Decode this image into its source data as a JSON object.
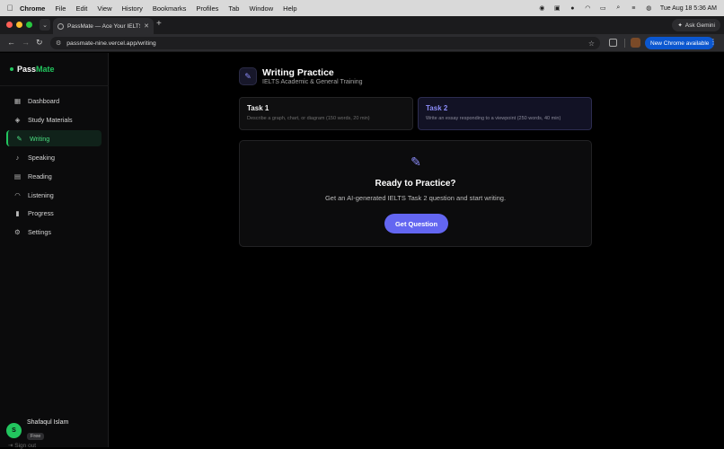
{
  "menubar": {
    "apple": "",
    "items": [
      "Chrome",
      "File",
      "Edit",
      "View",
      "History",
      "Bookmarks",
      "Profiles",
      "Tab",
      "Window",
      "Help"
    ],
    "datetime": "Tue Aug 18  5:36 AM"
  },
  "browser": {
    "tab_title": "PassMate — Ace Your IELTS",
    "tab_close": "✕",
    "new_tab": "+",
    "ask_gemini": "Ask Gemini",
    "url": "passmate-nine.vercel.app/writing",
    "update_label": "New Chrome available",
    "traffic_lights": {
      "close": "#ff5f57",
      "minimize": "#febc2e",
      "zoom": "#28c840"
    }
  },
  "sidebar": {
    "brand_part1": "Pass",
    "brand_part2": "Mate",
    "brand_color": "#22c55e",
    "items": [
      {
        "label": "Dashboard",
        "icon": "grid-icon"
      },
      {
        "label": "Study Materials",
        "icon": "graduation-cap-icon"
      },
      {
        "label": "Writing",
        "icon": "pen-nib-icon",
        "active": true
      },
      {
        "label": "Speaking",
        "icon": "microphone-icon"
      },
      {
        "label": "Reading",
        "icon": "book-icon"
      },
      {
        "label": "Listening",
        "icon": "headphones-icon"
      },
      {
        "label": "Progress",
        "icon": "bar-chart-icon"
      },
      {
        "label": "Settings",
        "icon": "gear-icon"
      }
    ],
    "user": {
      "initial": "S",
      "name": "Shafaqul Islam",
      "plan": "Free"
    },
    "signout": "Sign out"
  },
  "main": {
    "title": "Writing Practice",
    "subtitle": "IELTS Academic & General Training",
    "accent_color": "#6366f1",
    "tasks": [
      {
        "name": "Task 1",
        "desc": "Describe a graph, chart, or diagram (150 words, 20 min)",
        "selected": false
      },
      {
        "name": "Task 2",
        "desc": "Write an essay responding to a viewpoint (250 words, 40 min)",
        "selected": true
      }
    ],
    "card": {
      "title": "Ready to Practice?",
      "description": "Get an AI-generated IELTS Task 2 question and start writing.",
      "button_label": "Get Question"
    }
  }
}
